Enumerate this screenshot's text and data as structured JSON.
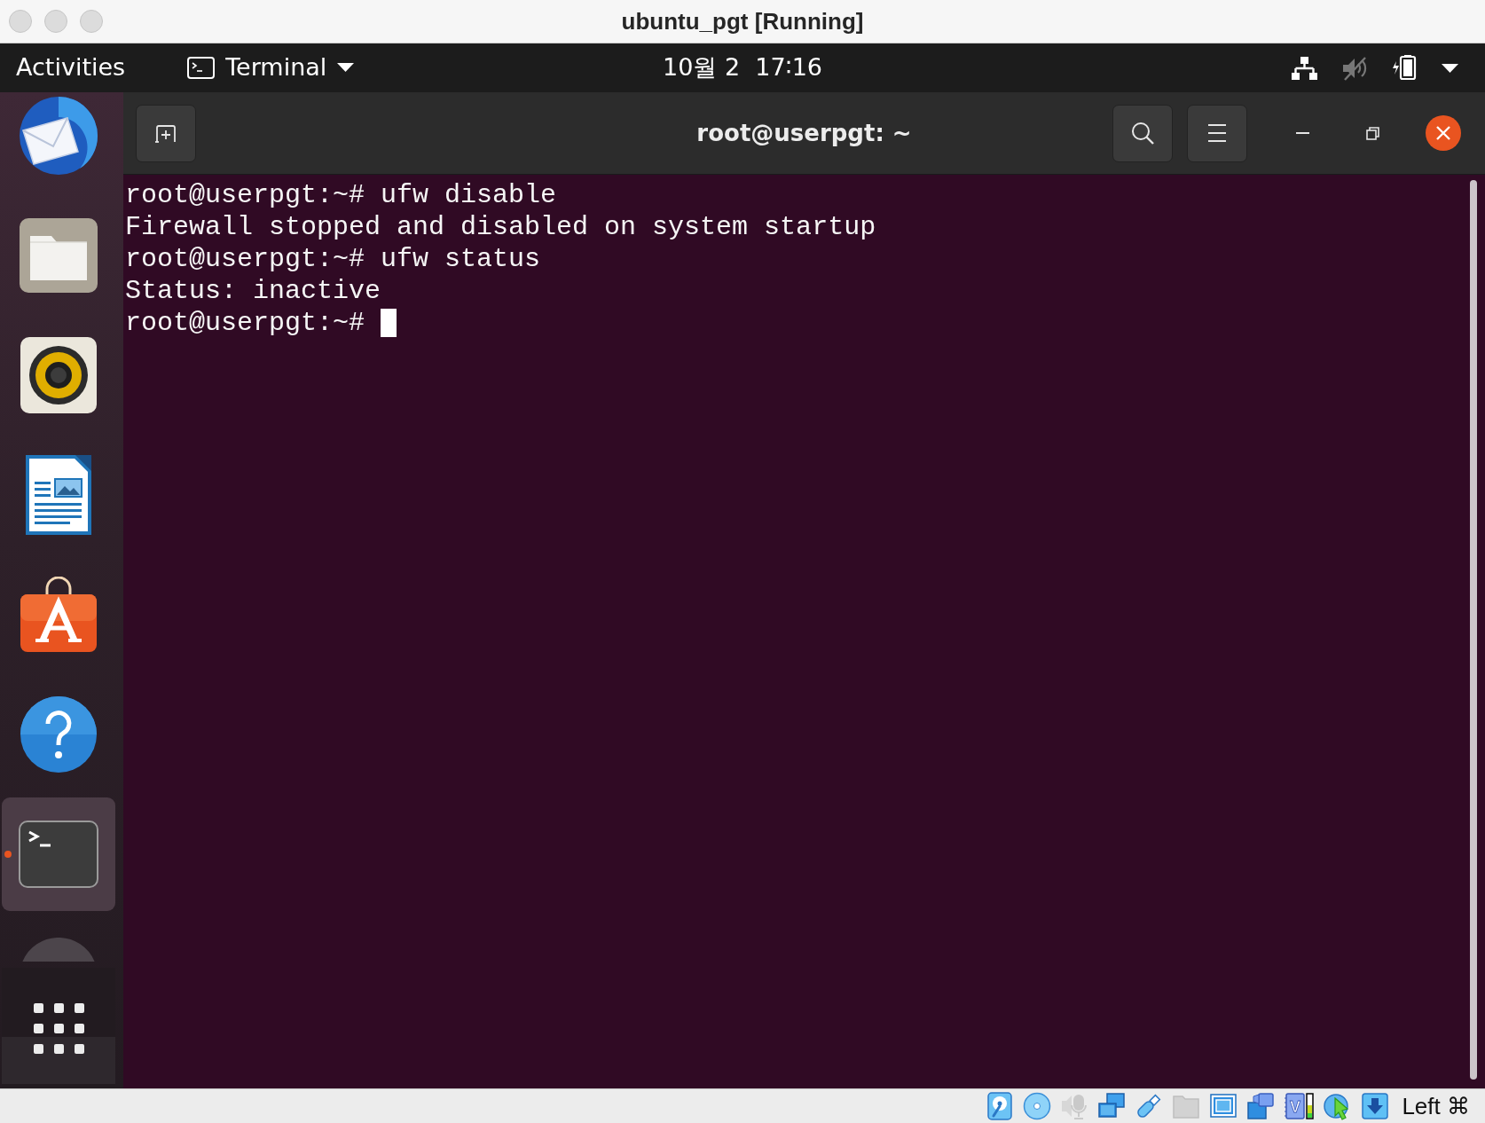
{
  "window": {
    "title": "ubuntu_pgt [Running]"
  },
  "top_bar": {
    "activities": "Activities",
    "app_menu": {
      "label": "Terminal"
    },
    "clock": "10월 2  17∶16",
    "system_menu": {
      "muted": true
    }
  },
  "dock": {
    "items": [
      {
        "kind": "mail",
        "selected": false,
        "running": false
      },
      {
        "kind": "files",
        "selected": false,
        "running": false
      },
      {
        "kind": "music",
        "selected": false,
        "running": false
      },
      {
        "kind": "writer",
        "selected": false,
        "running": false
      },
      {
        "kind": "software",
        "selected": false,
        "running": false
      },
      {
        "kind": "help",
        "selected": false,
        "running": false
      },
      {
        "kind": "terminal",
        "selected": true,
        "running": true
      },
      {
        "kind": "disc",
        "selected": false,
        "running": false
      }
    ]
  },
  "terminal": {
    "title": "root@userpgt: ~",
    "lines": [
      {
        "text": "root@userpgt:~# ufw disable",
        "cursor": false
      },
      {
        "text": "Firewall stopped and disabled on system startup",
        "cursor": false
      },
      {
        "text": "root@userpgt:~# ufw status",
        "cursor": false
      },
      {
        "text": "Status: inactive",
        "cursor": false
      },
      {
        "text": "root@userpgt:~#",
        "cursor": true
      }
    ]
  },
  "status_bar": {
    "indicators": [
      {
        "kind": "hard_disk",
        "active": true
      },
      {
        "kind": "optical_disc",
        "active": true
      },
      {
        "kind": "audio",
        "active": false
      },
      {
        "kind": "network",
        "active": true
      },
      {
        "kind": "usb",
        "active": true
      },
      {
        "kind": "shared_folders",
        "active": false
      },
      {
        "kind": "display",
        "active": true
      },
      {
        "kind": "recording",
        "active": true
      },
      {
        "kind": "cpu",
        "active": true,
        "label": "V"
      },
      {
        "kind": "mouse",
        "active": true
      },
      {
        "kind": "keyboard",
        "active": true
      }
    ],
    "host_key": "Left ⌘"
  }
}
